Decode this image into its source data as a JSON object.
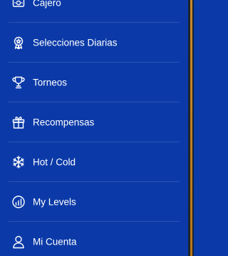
{
  "menu": {
    "items": [
      {
        "label": "Cajero",
        "icon": "cashier-icon"
      },
      {
        "label": "Selecciones Diarias",
        "icon": "medal-icon"
      },
      {
        "label": "Torneos",
        "icon": "trophy-icon"
      },
      {
        "label": "Recompensas",
        "icon": "gift-icon"
      },
      {
        "label": "Hot / Cold",
        "icon": "snowflake-icon"
      },
      {
        "label": "My Levels",
        "icon": "levels-icon"
      },
      {
        "label": "Mi Cuenta",
        "icon": "user-icon"
      }
    ]
  },
  "colors": {
    "menu_background": "#0b3aa8",
    "text": "#ffffff",
    "edge_dark": "#1c2330",
    "edge_accent": "#c98a2c"
  }
}
